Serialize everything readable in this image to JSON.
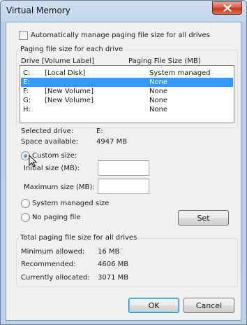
{
  "window": {
    "title": "Virtual Memory"
  },
  "auto_manage": {
    "label": "Automatically manage paging file size for all drives",
    "checked": false
  },
  "drives_group": {
    "title": "Paging file size for each drive",
    "header_drive": "Drive  [Volume Label]",
    "header_size": "Paging File Size (MB)",
    "rows": [
      {
        "drive": "C:",
        "label": "[Local Disk]",
        "size": "System managed"
      },
      {
        "drive": "E:",
        "label": "",
        "size": "None"
      },
      {
        "drive": "F:",
        "label": "[New Volume]",
        "size": "None"
      },
      {
        "drive": "G:",
        "label": "[New Volume]",
        "size": "None"
      },
      {
        "drive": "H:",
        "label": "",
        "size": "None"
      }
    ],
    "selected_index": 1
  },
  "selected_drive": {
    "label": "Selected drive:",
    "value": "E:"
  },
  "space_available": {
    "label": "Space available:",
    "value": "4947 MB"
  },
  "options": {
    "custom_size": "Custom size:",
    "initial_size_label": "Initial size (MB):",
    "initial_size_value": "",
    "maximum_size_label": "Maximum size (MB):",
    "maximum_size_value": "",
    "system_managed": "System managed size",
    "no_paging": "No paging file",
    "selected": "custom_size"
  },
  "set_button": "Set",
  "totals_group": {
    "title": "Total paging file size for all drives",
    "minimum_label": "Minimum allowed:",
    "minimum_value": "16 MB",
    "recommended_label": "Recommended:",
    "recommended_value": "4606 MB",
    "allocated_label": "Currently allocated:",
    "allocated_value": "3071 MB"
  },
  "ok_button": "OK",
  "cancel_button": "Cancel",
  "icons": {
    "close": "close-icon",
    "cursor": "mouse-pointer-icon"
  }
}
